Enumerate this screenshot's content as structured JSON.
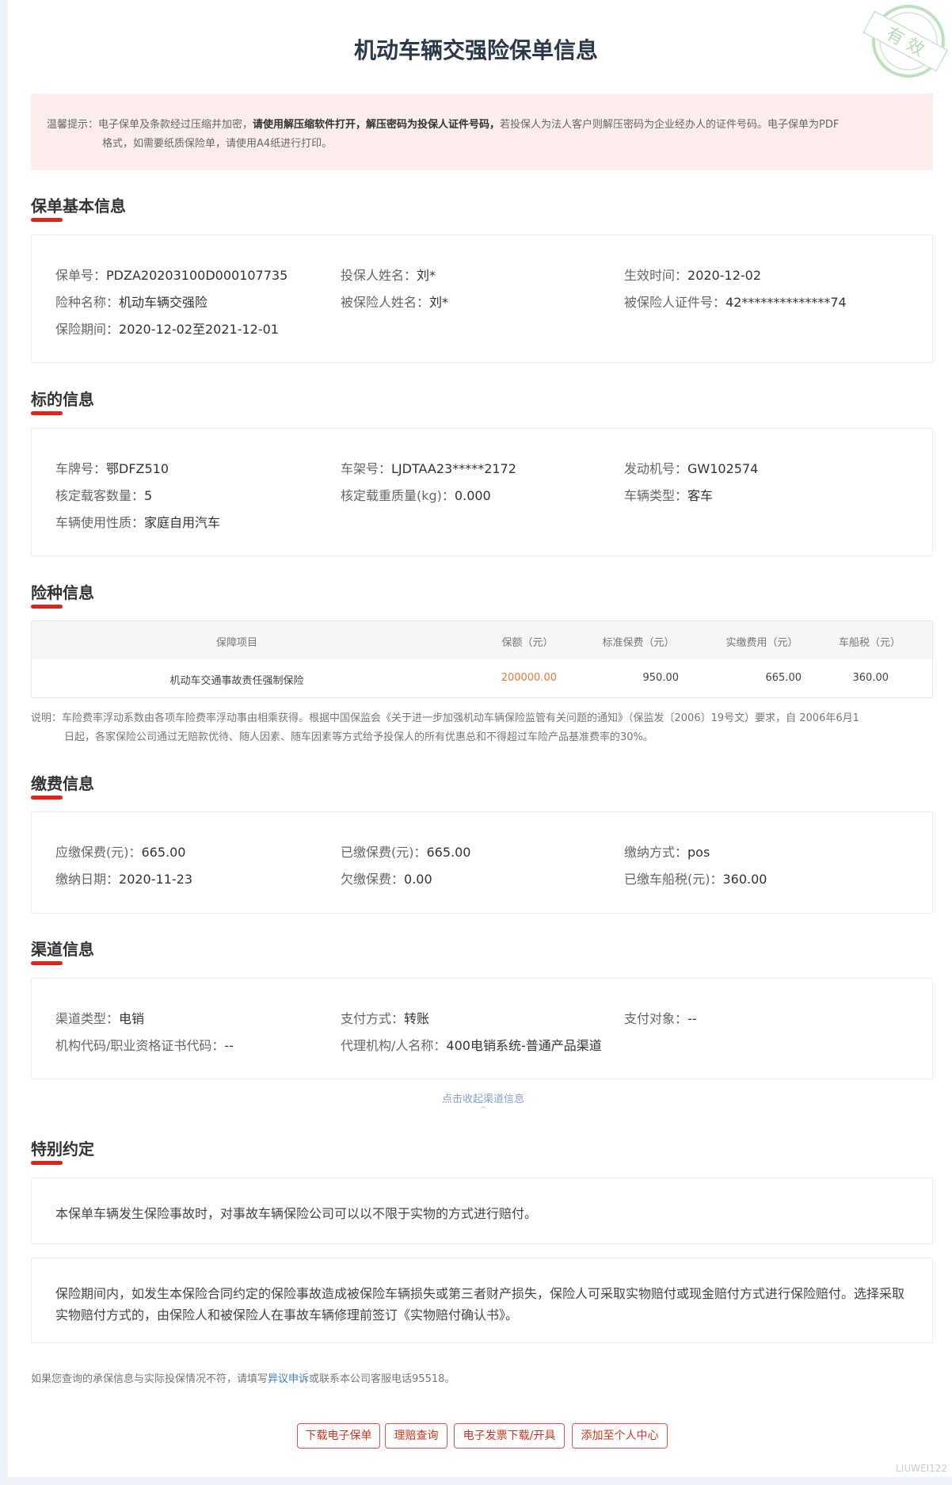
{
  "title": "机动车辆交强险保单信息",
  "stamp_text": "有效",
  "notice": {
    "label": "温馨提示：",
    "part1": "电子保单及条款经过压缩并加密，",
    "bold1": "请使用解压缩软件打开，解压密码为投保人证件号码，",
    "part2": "若投保人为法人客户则解压密码为企业经办人的证件号码。电子保单为PDF",
    "line2": "格式，如需要纸质保险单，请使用A4纸进行打印。"
  },
  "basic": {
    "title": "保单基本信息",
    "fields": [
      {
        "label": "保单号：",
        "value": "PDZA20203100D000107735"
      },
      {
        "label": "投保人姓名：",
        "value": "刘*"
      },
      {
        "label": "生效时间：",
        "value": "2020-12-02"
      },
      {
        "label": "险种名称：",
        "value": "机动车辆交强险"
      },
      {
        "label": "被保险人姓名：",
        "value": "刘*"
      },
      {
        "label": "被保险人证件号：",
        "value": "42**************74"
      },
      {
        "label": "保险期间：",
        "value": "2020-12-02至2021-12-01"
      }
    ]
  },
  "vehicle": {
    "title": "标的信息",
    "fields": [
      {
        "label": "车牌号：",
        "value": "鄂DFZ510"
      },
      {
        "label": "车架号：",
        "value": "LJDTAA23*****2172"
      },
      {
        "label": "发动机号：",
        "value": "GW102574"
      },
      {
        "label": "核定载客数量：",
        "value": "5"
      },
      {
        "label": "核定载重质量(kg)：",
        "value": "0.000"
      },
      {
        "label": "车辆类型：",
        "value": "客车"
      },
      {
        "label": "车辆使用性质：",
        "value": "家庭自用汽车"
      }
    ]
  },
  "coverage": {
    "title": "险种信息",
    "headers": [
      "保障项目",
      "保额（元）",
      "标准保费（元）",
      "实缴费用（元）",
      "车船税（元）"
    ],
    "rows": [
      [
        "机动车交通事故责任强制保险",
        "200000.00",
        "950.00",
        "665.00",
        "360.00"
      ]
    ],
    "amount_color": "#e07b3a",
    "note_line1": "说明：车险费率浮动系数由各项车险费率浮动事由相乘获得。根据中国保监会《关于进一步加强机动车辆保险监管有关问题的通知》（保监发〔2006〕19号文）要求，自 2006年6月1",
    "note_line2": "日起，各家保险公司通过无赔款优待、随人因素、随车因素等方式给予投保人的所有优惠总和不得超过车险产品基准费率的30%。"
  },
  "payment": {
    "title": "缴费信息",
    "fields": [
      {
        "label": "应缴保费(元)：",
        "value": "665.00"
      },
      {
        "label": "已缴保费(元)：",
        "value": "665.00"
      },
      {
        "label": "缴纳方式：",
        "value": "pos"
      },
      {
        "label": "缴纳日期：",
        "value": "2020-11-23"
      },
      {
        "label": "欠缴保费：",
        "value": "0.00"
      },
      {
        "label": "已缴车船税(元)：",
        "value": "360.00"
      }
    ]
  },
  "channel": {
    "title": "渠道信息",
    "fields": [
      {
        "label": "渠道类型：",
        "value": "电销"
      },
      {
        "label": "支付方式：",
        "value": "转账"
      },
      {
        "label": "支付对象：",
        "value": "--"
      },
      {
        "label": "机构代码/职业资格证书代码：",
        "value": "--"
      },
      {
        "label": "代理机构/人名称：",
        "value": "400电销系统-普通产品渠道"
      }
    ],
    "toggle": "点击收起渠道信息",
    "toggle_icon": "^"
  },
  "special": {
    "title": "特别约定",
    "item1": "本保单车辆发生保险事故时，对事故车辆保险公司可以以不限于实物的方式进行赔付。",
    "item2_line1": "保险期间内，如发生本保险合同约定的保险事故造成被保险车辆损失或第三者财产损失，保险人可采取实物赔付或现金赔付方式进行保险赔付。选择采取",
    "item2_line2": "实物赔付方式的，由保险人和被保险人在事故车辆修理前签订《实物赔付确认书》。"
  },
  "footer": {
    "pre": "如果您查询的承保信息与实际投保情况不符，请填写",
    "link": "异议申诉",
    "post": "或联系本公司客服电话95518。"
  },
  "buttons": [
    "下载电子保单",
    "理赔查询",
    "电子发票下载/开具",
    "添加至个人中心"
  ],
  "watermark": "LIUWEI122"
}
